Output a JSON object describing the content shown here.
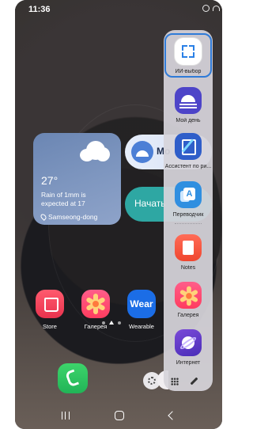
{
  "status_bar": {
    "time": "11:36"
  },
  "weather": {
    "temperature": "27°",
    "line1": "Rain of 1mm is",
    "line2": "expected at 17",
    "location": "Samseong-dong"
  },
  "widgets": {
    "brightness_label": "Mo",
    "start_label": "Начать"
  },
  "home_apps": [
    {
      "label": "Store",
      "icon": "store-icon"
    },
    {
      "label": "Галерея",
      "icon": "gallery-flower-icon"
    },
    {
      "label": "Wearable",
      "icon": "wear-icon",
      "icon_text": "Wear"
    }
  ],
  "edge_panel": {
    "apps": [
      {
        "label": "ИИ-выбор",
        "icon": "ai-select-icon",
        "selected": true
      },
      {
        "label": "Мой день",
        "icon": "my-day-icon"
      },
      {
        "label": "Ассистент по ри...",
        "icon": "drawing-assist-icon"
      },
      {
        "label": "Переводчик",
        "icon": "translator-icon",
        "icon_text": "A"
      },
      {
        "label": "Notes",
        "icon": "notes-icon"
      },
      {
        "label": "Галерея",
        "icon": "gallery-flower-icon"
      },
      {
        "label": "Интернет",
        "icon": "internet-icon"
      }
    ]
  },
  "colors": {
    "focus_outline": "#2f7bd8",
    "weather_bg": "#7f97c0",
    "edge_panel_bg": "#d6d4da"
  }
}
